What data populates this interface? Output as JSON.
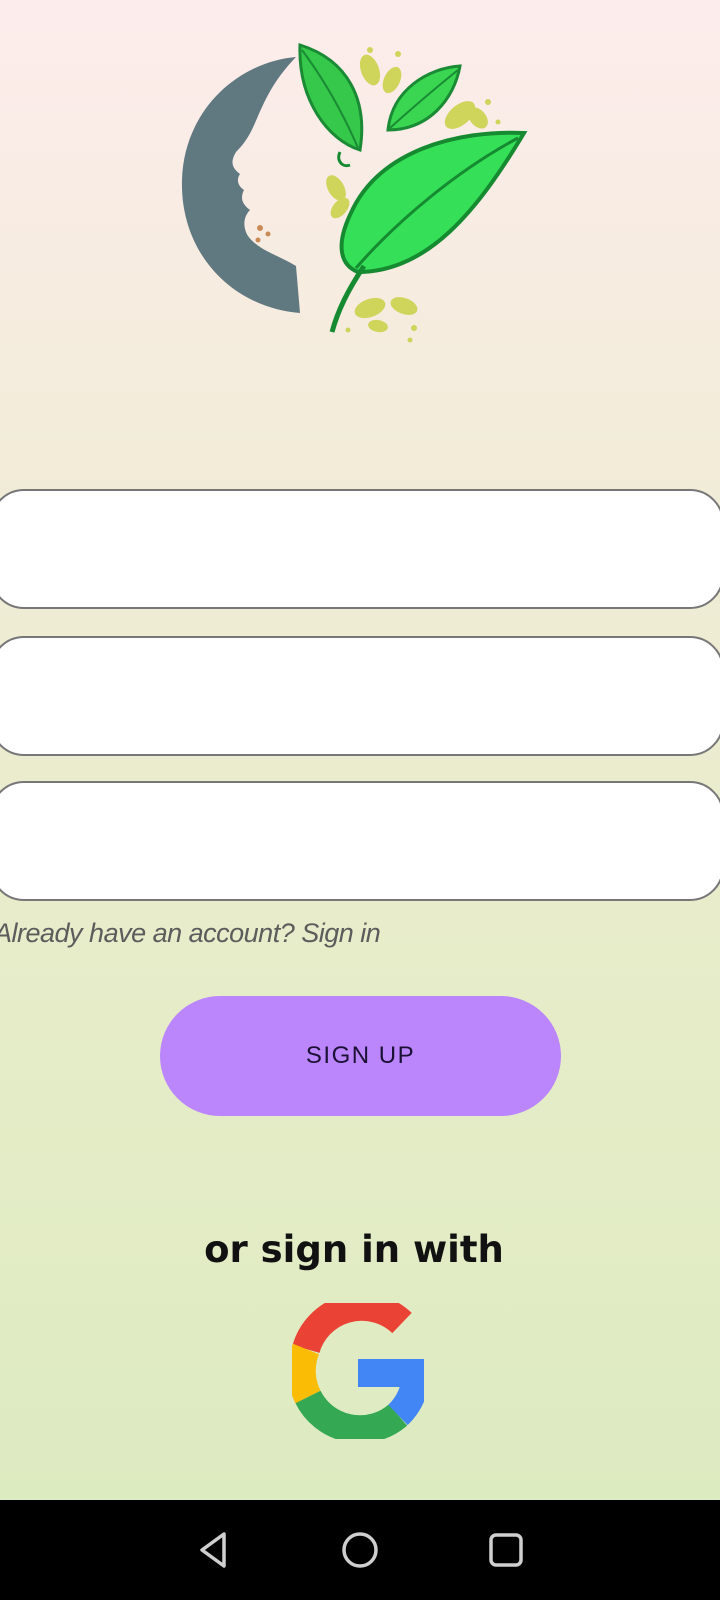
{
  "logo": {
    "icon": "face-leaf-logo"
  },
  "form": {
    "fields": [
      {
        "name": "field-1",
        "value": "",
        "placeholder": ""
      },
      {
        "name": "field-2",
        "value": "",
        "placeholder": ""
      },
      {
        "name": "field-3",
        "value": "",
        "placeholder": ""
      }
    ]
  },
  "signin_link": "Already have an account? Sign in",
  "signup_button": "SIGN UP",
  "social": {
    "label": "or sign in with",
    "google_icon": "google-g-icon"
  },
  "navbar": {
    "back_icon": "back-triangle-icon",
    "home_icon": "home-circle-icon",
    "recents_icon": "recents-square-icon"
  },
  "colors": {
    "accent": "#bb86fc",
    "background_top": "#fdecec",
    "background_bottom": "#ddebc1",
    "leaf_green": "#35d44b",
    "face_gray": "#607880"
  }
}
